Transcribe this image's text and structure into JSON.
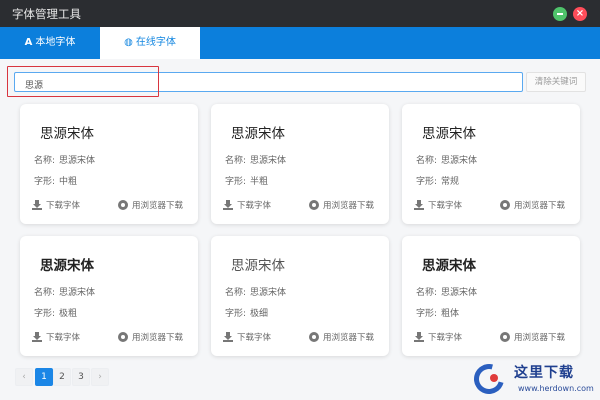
{
  "window": {
    "title": "字体管理工具",
    "close_glyph": "×"
  },
  "tabs": [
    {
      "icon": "A",
      "label": "本地字体"
    },
    {
      "icon": "◍",
      "label": "在线字体"
    }
  ],
  "search": {
    "value": "思源",
    "clear_label": "清除关键词"
  },
  "cards": [
    {
      "title": "思源宋体",
      "name_key": "名称:",
      "name_val": "思源宋体",
      "style_key": "字形:",
      "style_val": "中粗",
      "download": "下载字体",
      "browser": "用浏览器下载"
    },
    {
      "title": "思源宋体",
      "name_key": "名称:",
      "name_val": "思源宋体",
      "style_key": "字形:",
      "style_val": "半粗",
      "download": "下载字体",
      "browser": "用浏览器下载"
    },
    {
      "title": "思源宋体",
      "name_key": "名称:",
      "name_val": "思源宋体",
      "style_key": "字形:",
      "style_val": "常规",
      "download": "下载字体",
      "browser": "用浏览器下载"
    },
    {
      "title": "思源宋体",
      "name_key": "名称:",
      "name_val": "思源宋体",
      "style_key": "字形:",
      "style_val": "极粗",
      "download": "下载字体",
      "browser": "用浏览器下载"
    },
    {
      "title": "思源宋体",
      "name_key": "名称:",
      "name_val": "思源宋体",
      "style_key": "字形:",
      "style_val": "极细",
      "download": "下载字体",
      "browser": "用浏览器下载"
    },
    {
      "title": "思源宋体",
      "name_key": "名称:",
      "name_val": "思源宋体",
      "style_key": "字形:",
      "style_val": "粗体",
      "download": "下载字体",
      "browser": "用浏览器下载"
    }
  ],
  "pagination": {
    "prev": "‹",
    "pages": [
      "1",
      "2",
      "3"
    ],
    "current": "1",
    "next": "›"
  },
  "watermark": {
    "text": "这里下载",
    "url": "www.herdown.com"
  },
  "colors": {
    "titlebar": "#2b2d31",
    "tabbar": "#0c7fdc",
    "accent": "#1b86e6",
    "highlight_box": "#d8353f"
  }
}
